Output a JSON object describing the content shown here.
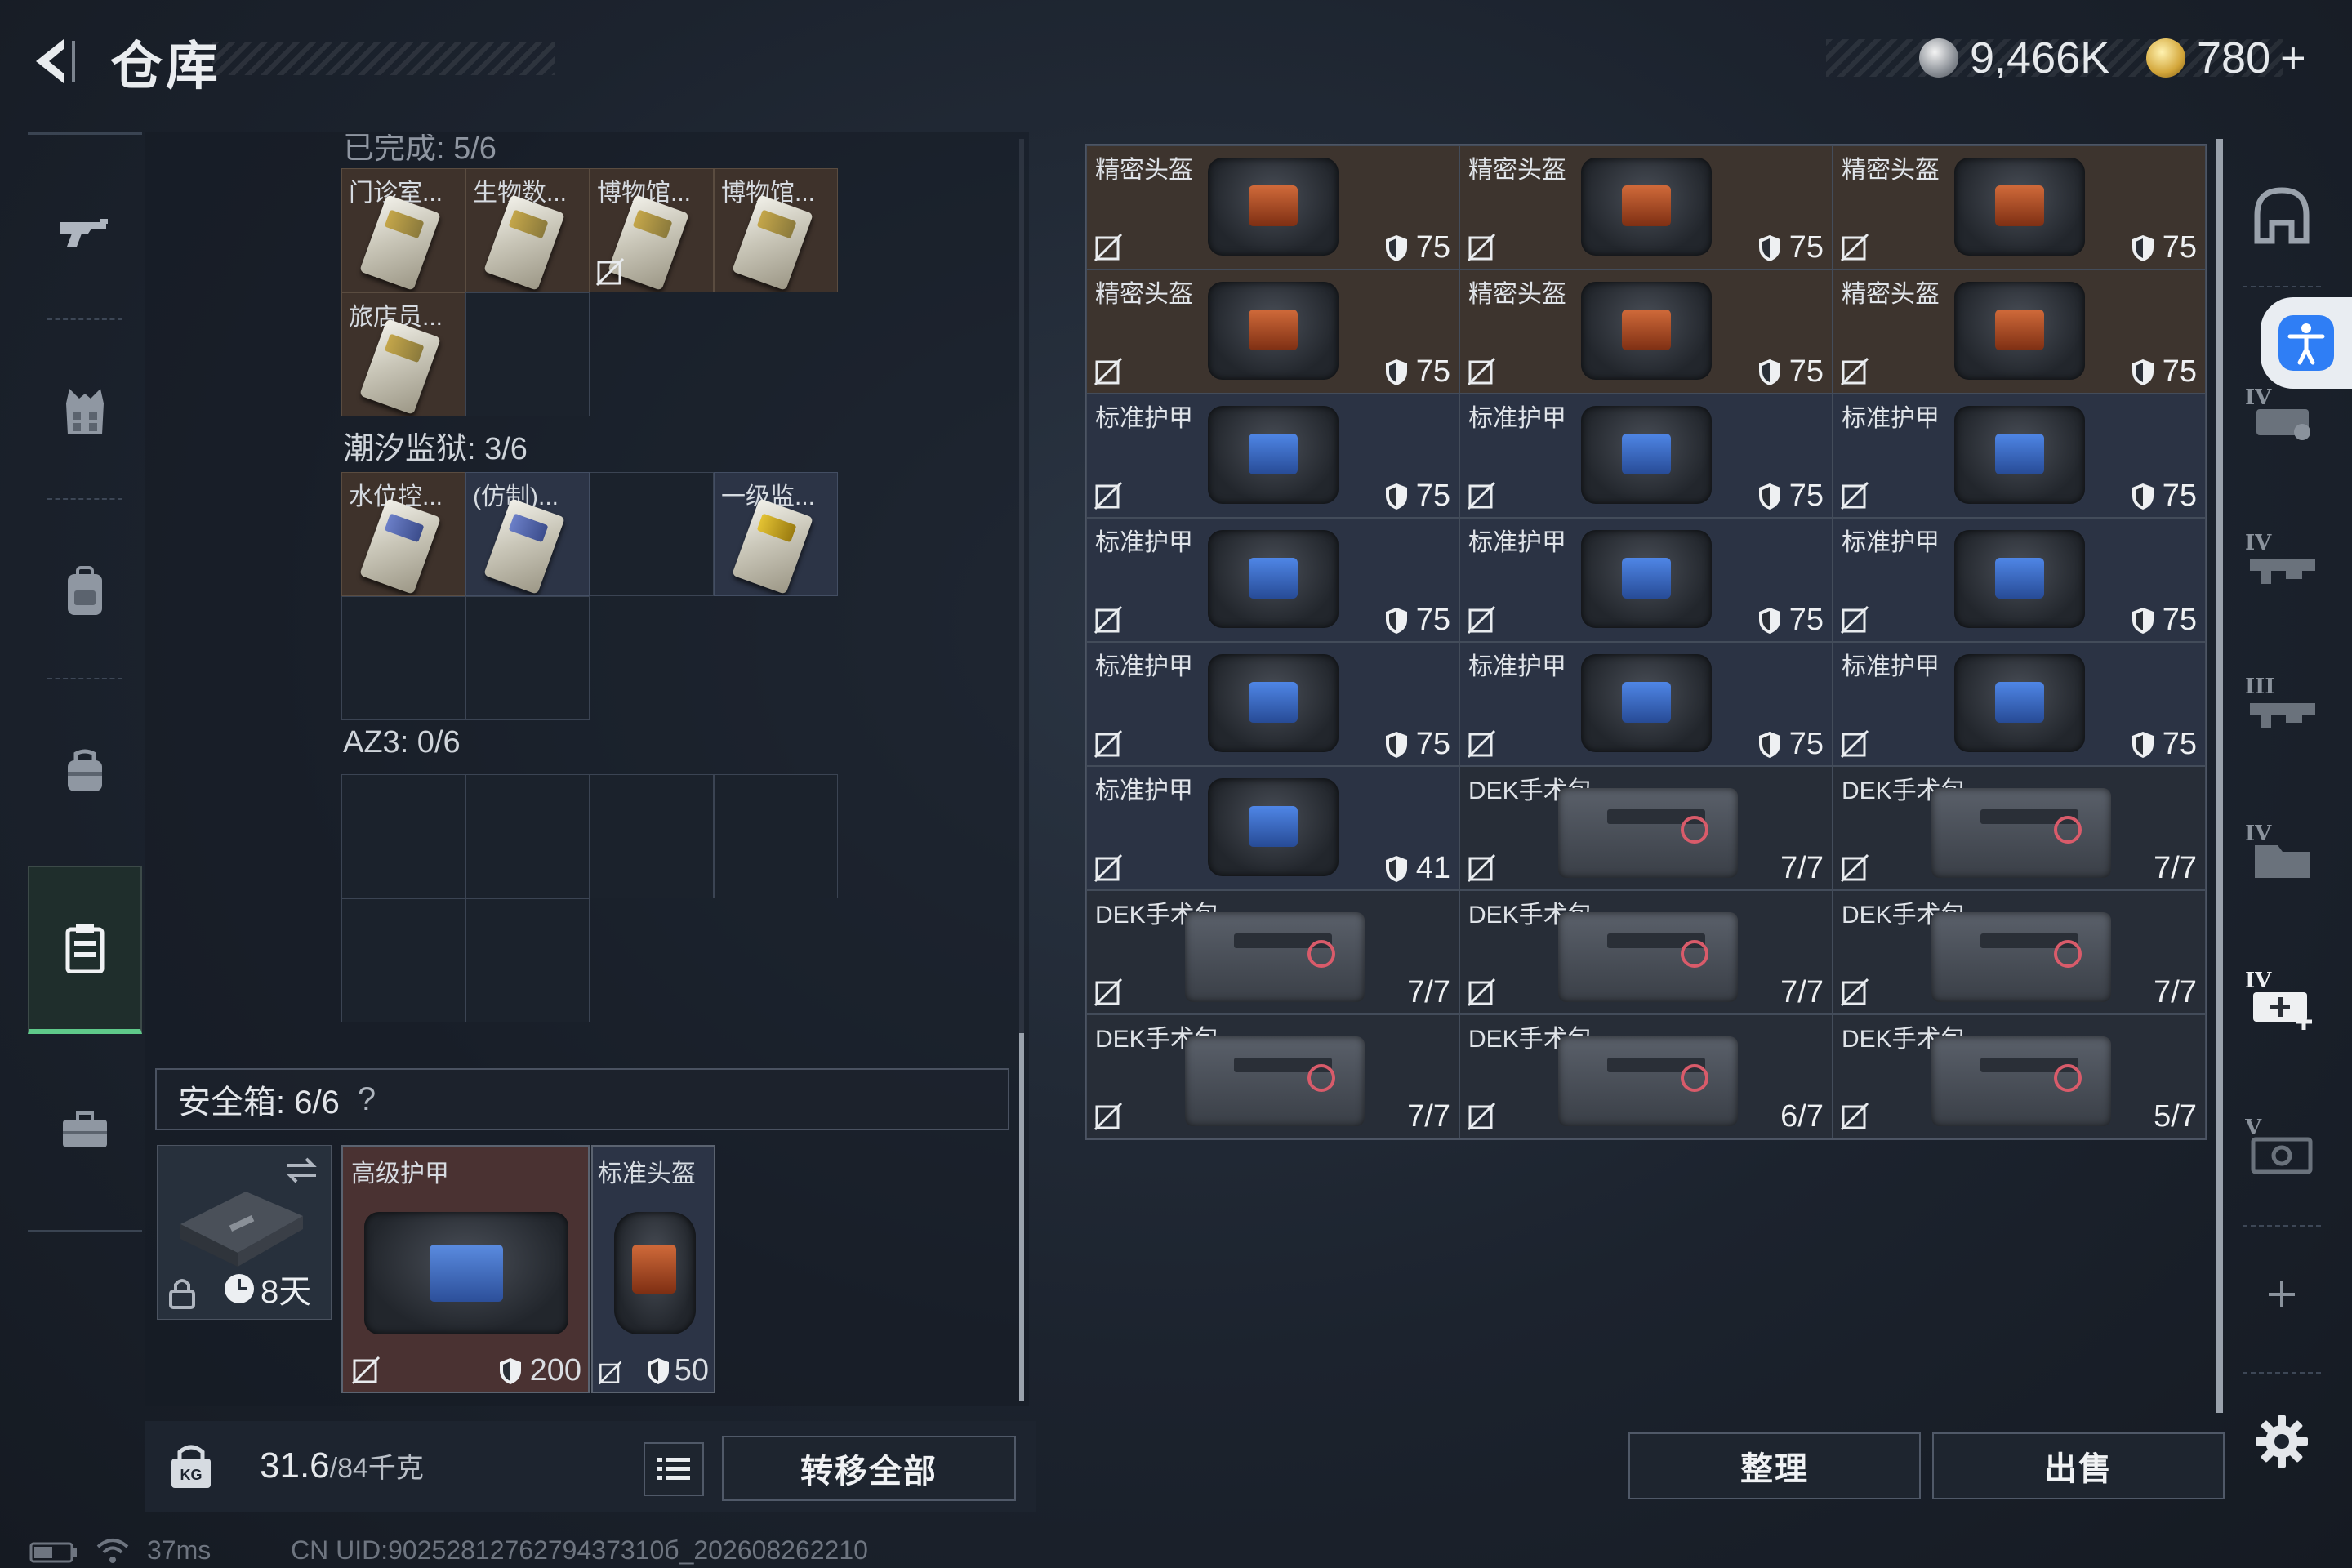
{
  "header": {
    "title": "仓库",
    "currency_silver": "9,466K",
    "currency_gold": "780",
    "gold_plus": "+"
  },
  "left": {
    "cut_top_label": "已完成: 5/6",
    "keycards_row1": [
      "门诊室...",
      "生物数...",
      "博物馆...",
      "博物馆..."
    ],
    "keycards_row2": [
      "旅店员..."
    ],
    "section_tide": "潮汐监狱: 3/6",
    "tide_cards": [
      "水位控...",
      "(仿制)...",
      "",
      "一级监..."
    ],
    "section_az3": "AZ3: 0/6",
    "safebox_label": "安全箱: 6/6",
    "safebox_help": "?",
    "safebox_timer": "8天",
    "safe_items": [
      {
        "name": "高级护甲",
        "value": "200"
      },
      {
        "name": "标准头盔",
        "value": "50"
      }
    ]
  },
  "bottom": {
    "weight_current": "31.6",
    "weight_max": "/84千克",
    "transfer_all": "转移全部",
    "sort": "整理",
    "sell": "出售"
  },
  "status": {
    "ping": "37ms",
    "uid": "CN UID:9025281276279437310б_202608262210"
  },
  "inventory": [
    {
      "name": "精密头盔",
      "value": "75",
      "tone": "orange",
      "kind": "helmet"
    },
    {
      "name": "精密头盔",
      "value": "75",
      "tone": "orange",
      "kind": "helmet"
    },
    {
      "name": "精密头盔",
      "value": "75",
      "tone": "orange",
      "kind": "helmet"
    },
    {
      "name": "精密头盔",
      "value": "75",
      "tone": "orange",
      "kind": "helmet"
    },
    {
      "name": "精密头盔",
      "value": "75",
      "tone": "orange",
      "kind": "helmet"
    },
    {
      "name": "精密头盔",
      "value": "75",
      "tone": "orange",
      "kind": "helmet"
    },
    {
      "name": "标准护甲",
      "value": "75",
      "tone": "blue",
      "kind": "armor"
    },
    {
      "name": "标准护甲",
      "value": "75",
      "tone": "blue",
      "kind": "armor"
    },
    {
      "name": "标准护甲",
      "value": "75",
      "tone": "blue",
      "kind": "armor"
    },
    {
      "name": "标准护甲",
      "value": "75",
      "tone": "blue",
      "kind": "armor"
    },
    {
      "name": "标准护甲",
      "value": "75",
      "tone": "blue",
      "kind": "armor"
    },
    {
      "name": "标准护甲",
      "value": "75",
      "tone": "blue",
      "kind": "armor"
    },
    {
      "name": "标准护甲",
      "value": "75",
      "tone": "blue",
      "kind": "armor"
    },
    {
      "name": "标准护甲",
      "value": "75",
      "tone": "blue",
      "kind": "armor"
    },
    {
      "name": "标准护甲",
      "value": "75",
      "tone": "blue",
      "kind": "armor"
    },
    {
      "name": "标准护甲",
      "value": "41",
      "tone": "blue",
      "kind": "armor"
    },
    {
      "name": "DEK手术包",
      "value": "7/7",
      "tone": "dark",
      "kind": "medkit"
    },
    {
      "name": "DEK手术包",
      "value": "7/7",
      "tone": "dark",
      "kind": "medkit"
    },
    {
      "name": "DEK手术包",
      "value": "7/7",
      "tone": "dark",
      "kind": "medkit"
    },
    {
      "name": "DEK手术包",
      "value": "7/7",
      "tone": "dark",
      "kind": "medkit"
    },
    {
      "name": "DEK手术包",
      "value": "7/7",
      "tone": "dark",
      "kind": "medkit"
    },
    {
      "name": "DEK手术包",
      "value": "7/7",
      "tone": "dark",
      "kind": "medkit"
    },
    {
      "name": "DEK手术包",
      "value": "6/7",
      "tone": "dark",
      "kind": "medkit"
    },
    {
      "name": "DEK手术包",
      "value": "5/7",
      "tone": "dark",
      "kind": "medkit"
    }
  ],
  "left_nav_icons": [
    "gun-icon",
    "vest-icon",
    "backpack-icon",
    "bag-icon",
    "container-icon",
    "briefcase-icon"
  ],
  "right_nav_icons": [
    "helmet-icon",
    "armor-IV-icon",
    "rifle-IV-icon",
    "rifle-III-icon",
    "folder-IV-icon",
    "medkit-IV-icon",
    "chest-V-icon",
    "plus-icon",
    "gear-icon"
  ],
  "colors": {
    "accent_green": "#5fc98a",
    "orange_cell": "#3d342e",
    "blue_cell": "#2b3344"
  }
}
